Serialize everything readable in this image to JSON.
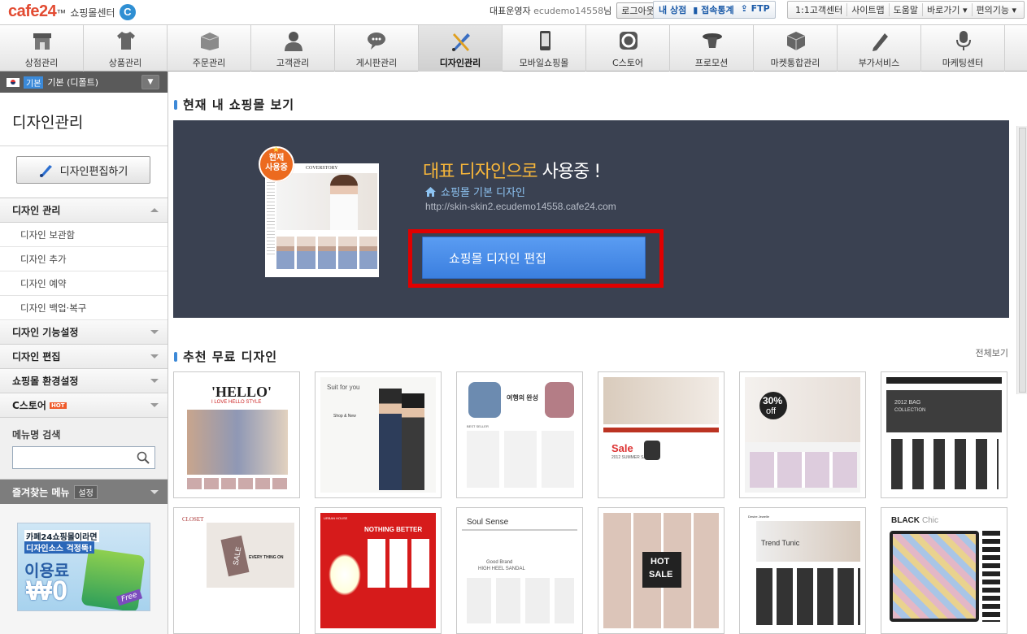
{
  "topbar": {
    "logo_text": "cafe24",
    "logo_tm": "™",
    "logo_sub": "쇼핑몰센터",
    "logo_badge": "C",
    "operator": "대표운영자",
    "user_id": "ecudemo14558",
    "user_suffix": "님",
    "logout": "로그아웃",
    "quick": [
      "내 상점",
      "접속통계",
      "FTP"
    ],
    "links": [
      "1:1고객센터",
      "사이트맵",
      "도움말",
      "바로가기 ▾",
      "편의기능 ▾"
    ]
  },
  "gnb": [
    {
      "label": "상점관리",
      "icon": "store-icon"
    },
    {
      "label": "상품관리",
      "icon": "shirt-icon"
    },
    {
      "label": "주문관리",
      "icon": "box-icon"
    },
    {
      "label": "고객관리",
      "icon": "person-icon"
    },
    {
      "label": "게시판관리",
      "icon": "chat-icon"
    },
    {
      "label": "디자인관리",
      "icon": "brush-pencil-icon",
      "active": true
    },
    {
      "label": "모바일쇼핑몰",
      "icon": "mobile-icon"
    },
    {
      "label": "C스토어",
      "icon": "cstore-icon"
    },
    {
      "label": "프로모션",
      "icon": "hat-icon"
    },
    {
      "label": "마켓통합관리",
      "icon": "cube-icon"
    },
    {
      "label": "부가서비스",
      "icon": "pen-icon"
    },
    {
      "label": "마케팅센터",
      "icon": "microphone-icon"
    }
  ],
  "sidebar": {
    "shop_badge": "기본",
    "shop_name": "기본 (디폴트)",
    "title": "디자인관리",
    "edit_button": "디자인편집하기",
    "section1": "디자인 관리",
    "sub_items": [
      "디자인 보관함",
      "디자인 추가",
      "디자인 예약",
      "디자인 백업·복구"
    ],
    "categories": [
      "디자인 기능설정",
      "디자인 편집",
      "쇼핑몰 환경설정",
      "C스토어"
    ],
    "hot": "HOT",
    "search_title": "메뉴명 검색",
    "search_value": "",
    "fav_title": "즐겨찾는 메뉴",
    "fav_setting": "설정",
    "ad": {
      "line1": "카페24쇼핑몰이라면",
      "line2": "디자인소스 걱정뚝!",
      "line3": "이용료",
      "line4": "₩0",
      "tag": "Free"
    }
  },
  "main": {
    "current_title": "현재 내 쇼핑몰 보기",
    "badge": [
      "현재",
      "사용중"
    ],
    "badge_star": "★",
    "thumb_brand": "COVERSTORY",
    "using_highlight": "대표 디자인으로",
    "using_rest": " 사용중 !",
    "design_name": "쇼핑몰 기본 디자인",
    "design_url": "http://skin-skin2.ecudemo14558.cafe24.com",
    "edit_button": "쇼핑몰 디자인 편집",
    "recommend_title": "추천 무료 디자인",
    "view_all": "전체보기",
    "cards": [
      {
        "text1": "'HELLO'",
        "text2": "I LOVE HELLO STYLE"
      },
      {
        "text1": "Suit for you",
        "text2": "Shop & New"
      },
      {
        "text1": "여행의 완성",
        "text2": "BEST SELLER"
      },
      {
        "text1": "2012 SUMMER SALE",
        "text2": "Sale"
      },
      {
        "text1": "30%",
        "text2": "off"
      },
      {
        "text1": "2012 BAG",
        "text2": "COLLECTION"
      },
      {
        "text1": "CLOSET",
        "text2": "EVERY THING ON",
        "text3": "SALE"
      },
      {
        "text1": "NOTHING BETTER",
        "text2": "URBAN HOUSE"
      },
      {
        "text1": "Soul Sense",
        "text2": "Good Brand",
        "text3": "HIGH HEEL SANDAL"
      },
      {
        "text1": "HOT",
        "text2": "SALE"
      },
      {
        "text1": "Trend Tunic",
        "text2": "Desire Jewelle"
      },
      {
        "text1": "BLACK",
        "text2": "Chic"
      }
    ]
  },
  "colors": {
    "accent": "#3d89d7",
    "hero_bg": "#3a4151",
    "highlight_border": "#e10000",
    "orange": "#f7b63a"
  }
}
